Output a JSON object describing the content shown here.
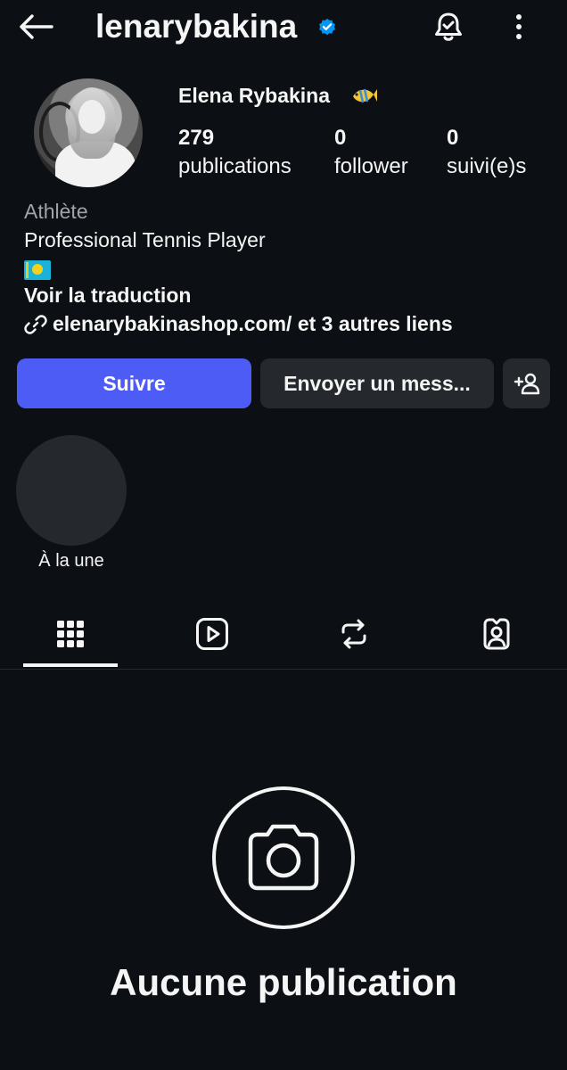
{
  "header": {
    "username": "lenarybakina",
    "icons": {
      "back": "arrow-left-icon",
      "verified": "verified-badge-icon",
      "notifications": "bell-check-icon",
      "more": "more-vertical-icon"
    }
  },
  "profile": {
    "full_name": "Elena Rybakina",
    "name_emoji": "tropical-fish-icon",
    "stats": [
      {
        "value": "279",
        "label": "publications"
      },
      {
        "value": "0",
        "label": "follower"
      },
      {
        "value": "0",
        "label": "suivi(e)s"
      }
    ],
    "category": "Athlète",
    "bio": "Professional Tennis Player",
    "bio_emoji": "kazakhstan-flag-icon",
    "translate": "Voir la traduction",
    "links": "elenarybakinashop.com/ et 3 autres liens"
  },
  "actions": {
    "follow": "Suivre",
    "message": "Envoyer un mess...",
    "add_user_icon": "add-person-icon"
  },
  "highlights": [
    {
      "label": "À la une"
    }
  ],
  "tabs": [
    {
      "icon": "grid-icon",
      "active": true
    },
    {
      "icon": "reels-icon",
      "active": false
    },
    {
      "icon": "repost-icon",
      "active": false
    },
    {
      "icon": "tagged-icon",
      "active": false
    }
  ],
  "empty_state": {
    "icon": "camera-icon",
    "title": "Aucune publication"
  },
  "colors": {
    "background": "#0c1014",
    "primary_button": "#4d5cf5",
    "secondary_button": "#25292e",
    "verified": "#0095f6",
    "muted_text": "#a0a4aa"
  }
}
